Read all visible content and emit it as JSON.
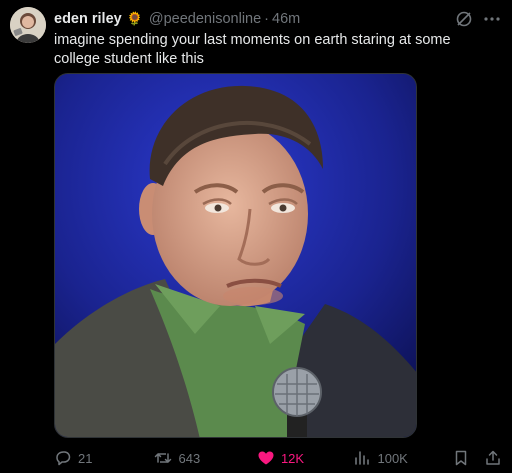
{
  "author": {
    "name": "eden riley",
    "badge_emoji": "🌻",
    "handle": "@peedenisonline",
    "separator": "·",
    "time": "46m"
  },
  "tweet_text": "imagine spending your last moments on earth staring at some college student like this",
  "actions": {
    "replies": "21",
    "reposts": "643",
    "likes": "12K",
    "views": "100K",
    "liked": true
  },
  "icons": {
    "avatar": "avatar",
    "grok": "grok-icon",
    "more": "more-icon",
    "reply": "reply-icon",
    "repost": "repost-icon",
    "like": "heart-icon",
    "views": "views-icon",
    "bookmark": "bookmark-icon",
    "share": "share-icon"
  },
  "colors": {
    "background": "#000000",
    "text": "#e7e9ea",
    "muted": "#71767b",
    "like": "#f91880",
    "stage_blue": "#1f2aa8"
  }
}
